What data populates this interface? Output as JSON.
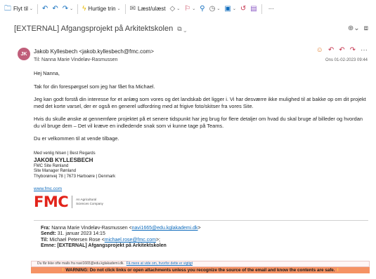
{
  "toolbar": {
    "move_label": "Flyt til",
    "quick_steps_label": "Hurtige trin",
    "read_unread_label": "Læst/ulæst",
    "more_label": "···"
  },
  "email": {
    "subject": "[EXTERNAL] Afgangsprojekt på Arkitektskolen",
    "avatar_initials": "JK",
    "from": "Jakob Kyllesbech <jakob.kyllesbech@fmc.com>",
    "to_label": "Til:",
    "to": "Nanna Marie Vindeløv-Rasmussen",
    "date": "Ons 01-02-2023 09:44",
    "body": [
      "Hej Nanna,",
      "Tak for din forespørgsel som jeg har fået fra Michael.",
      "Jeg kan godt forstå din interesse for et anlæg som vores og det landskab det ligger i. Vi har desværre ikke mulighed til at bakke op om dit projekt med det korte varsel, der er også en generel udfordring med at frigive foto/skitser fra vores Site.",
      "Hvis du skulle ønske at gennemføre projektet på et senere tidspunkt har jeg brug for flere detaljer om hvad du skal bruge af billeder og hvordan du vil bruge dem – Det vil kræve en indledende snak som vi kunne tage på Teams.",
      "Du er velkommen til at vende tilbage."
    ],
    "signature": {
      "greeting": "Med venlig hilsen | Best Regards",
      "name": "JAKOB KYLLESBECH",
      "line1": "FMC Site Rønland",
      "line2": "Site Manager Rønland",
      "line3": "Thyborønvej 78 | 7673 Harboøre | Denmark",
      "website": "www.fmc.com",
      "logo_text": "FMC",
      "logo_tagline": "An Agricultural Sciences Company"
    },
    "forwarded": {
      "from_label": "Fra:",
      "from_name": "Nanna Marie Vindeløv-Rasmussen <",
      "from_email": "navi1665@edu.kglakademi.dk",
      "from_end": ">",
      "sent_label": "Sendt:",
      "sent": "31. januar 2023 14:15",
      "to_label": "Til:",
      "to_name": "Michael Petersen Rose <",
      "to_email": "michael.rose@fmc.com",
      "to_end": ">;",
      "subject_label": "Emne:",
      "subject": "[EXTERNAL] Afgangsprojekt på Arkitektskolen"
    },
    "external_notice": "Du får ikke ofte mails fra navi1665@edu.kglakademi.dk.",
    "external_link": "Få mere at vide om, hvorfor dette er vigtigt",
    "warning": "WARNING: Do not click links or open attachments unless you recognize the source of the email and know the contents are safe."
  }
}
